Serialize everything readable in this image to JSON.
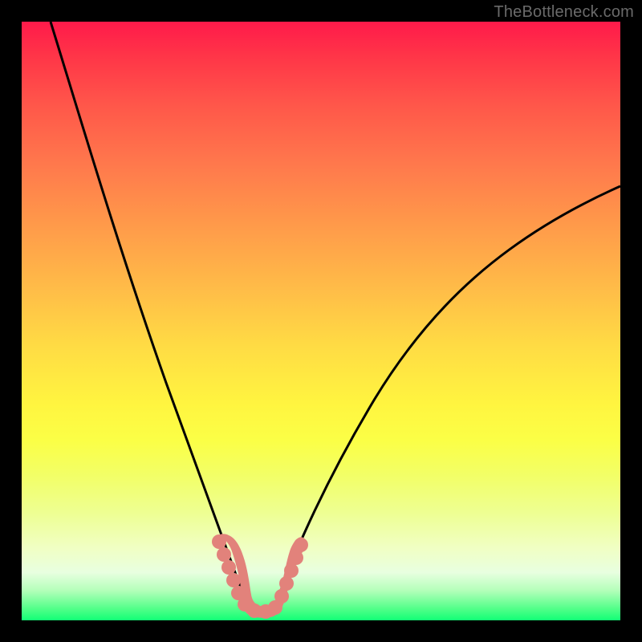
{
  "watermark": "TheBottleneck.com",
  "chart_data": {
    "type": "line",
    "title": "",
    "xlabel": "",
    "ylabel": "",
    "xlim": [
      0,
      100
    ],
    "ylim": [
      0,
      100
    ],
    "grid": false,
    "legend": false,
    "background": "rainbow-vertical-gradient",
    "annotations": [
      {
        "type": "valley-marker",
        "x_range": [
          32,
          44
        ],
        "y_range": [
          86,
          100
        ],
        "color": "#e2827b"
      }
    ],
    "series": [
      {
        "name": "left-curve",
        "color": "#000000",
        "x": [
          5,
          8,
          12,
          16,
          20,
          24,
          28,
          31,
          33,
          35,
          37
        ],
        "y": [
          100,
          86,
          70,
          56,
          44,
          32,
          20,
          12,
          8,
          5,
          2
        ]
      },
      {
        "name": "right-curve",
        "color": "#000000",
        "x": [
          40,
          43,
          47,
          52,
          58,
          65,
          73,
          82,
          92,
          100
        ],
        "y": [
          2,
          6,
          12,
          20,
          30,
          40,
          50,
          58,
          65,
          70
        ]
      }
    ]
  }
}
